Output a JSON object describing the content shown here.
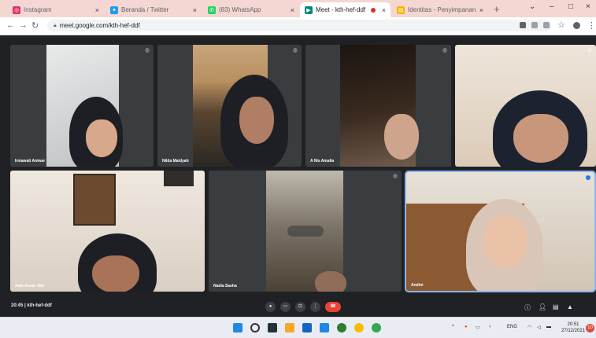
{
  "browser": {
    "tabs": [
      {
        "title": "Instagram",
        "icon": "instagram-icon",
        "color": "#e1306c",
        "active": false
      },
      {
        "title": "Beranda / Twitter",
        "icon": "twitter-icon",
        "color": "#1d9bf0",
        "active": false
      },
      {
        "title": "(83) WhatsApp",
        "icon": "whatsapp-icon",
        "color": "#25d366",
        "active": false
      },
      {
        "title": "Meet - kth-hef-ddf",
        "icon": "meet-icon",
        "color": "#00897b",
        "active": true
      },
      {
        "title": "Identitas - Penyimpanan Dar",
        "icon": "document-icon",
        "color": "#f4b400",
        "active": false
      }
    ],
    "url": "meet.google.com/kth-hef-ddf"
  },
  "participants": [
    {
      "name": "Irmawati Aniwar"
    },
    {
      "name": "Nilda Maidyah"
    },
    {
      "name": "A Nis Amalia"
    },
    {
      "name": ""
    },
    {
      "name": "Anis Anuar Jidi"
    },
    {
      "name": "Nadia Sasha"
    },
    {
      "name": ""
    },
    {
      "name": "Andini"
    }
  ],
  "meeting": {
    "time": "20:45",
    "separator": "|",
    "code": "kth-hef-ddf"
  },
  "taskbar": {
    "lang": "ENG",
    "time": "20:51",
    "date": "27/12/2021",
    "notifications": "10"
  }
}
